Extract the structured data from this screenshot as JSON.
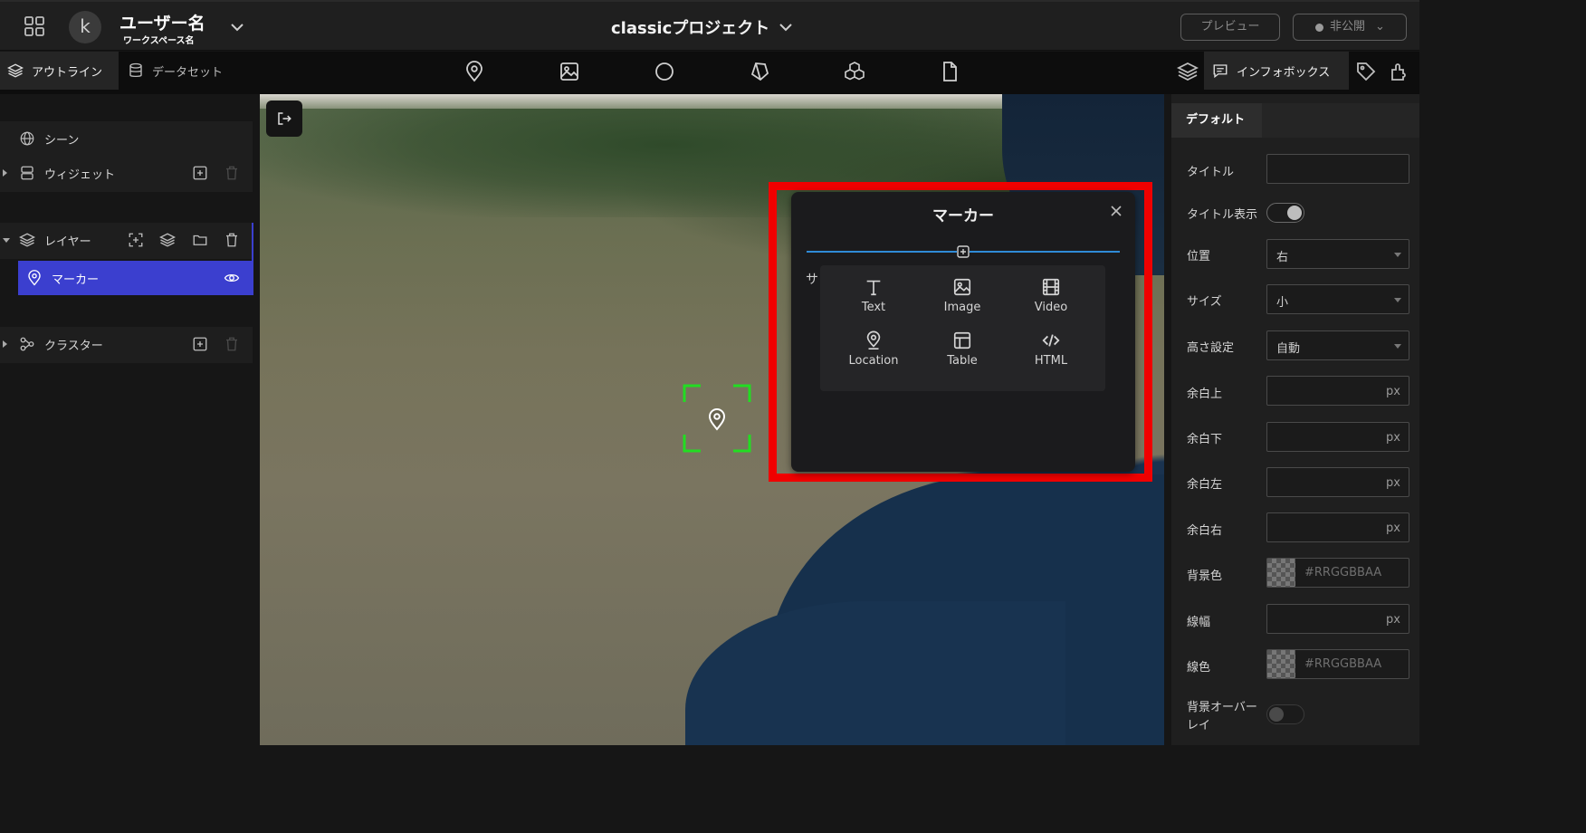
{
  "header": {
    "user_avatar_initial": "k",
    "user_name": "ユーザー名",
    "workspace_name": "ワークスペース名",
    "project_title": "classicプロジェクト",
    "preview_label": "プレビュー",
    "publish_status_label": "非公開"
  },
  "toolbar": {
    "left_tabs": [
      {
        "label": "アウトライン",
        "icon": "layers-icon",
        "active": true
      },
      {
        "label": "データセット",
        "icon": "database-icon",
        "active": false
      }
    ],
    "center_tools": [
      "marker-icon",
      "image-icon",
      "circle-icon",
      "polygon-icon",
      "model-icon",
      "file-icon"
    ],
    "right_tabs": [
      {
        "icon": "layers-icon"
      },
      {
        "label": "インフォボックス",
        "icon": "infobox-icon",
        "active": true
      },
      {
        "icon": "tag-icon"
      },
      {
        "icon": "plugin-icon"
      }
    ]
  },
  "outline": {
    "scene_label": "シーン",
    "widget_label": "ウィジェット",
    "layer_label": "レイヤー",
    "marker_label": "マーカー",
    "cluster_label": "クラスター"
  },
  "popup": {
    "title": "マーカー",
    "partial_text": "サ",
    "blocks": [
      {
        "label": "Text",
        "icon": "text-icon"
      },
      {
        "label": "Image",
        "icon": "image-icon"
      },
      {
        "label": "Video",
        "icon": "video-icon"
      },
      {
        "label": "Location",
        "icon": "location-icon"
      },
      {
        "label": "Table",
        "icon": "table-icon"
      },
      {
        "label": "HTML",
        "icon": "code-icon"
      }
    ]
  },
  "infobox": {
    "tab_default": "デフォルト",
    "fields": {
      "title_label": "タイトル",
      "title_value": "",
      "show_title_label": "タイトル表示",
      "show_title_on": true,
      "position_label": "位置",
      "position_value": "右",
      "size_label": "サイズ",
      "size_value": "小",
      "height_label": "高さ設定",
      "height_value": "自動",
      "margin_top_label": "余白上",
      "margin_bottom_label": "余白下",
      "margin_left_label": "余白左",
      "margin_right_label": "余白右",
      "unit": "px",
      "bg_color_label": "背景色",
      "color_placeholder": "#RRGGBBAA",
      "border_width_label": "線幅",
      "border_color_label": "線色",
      "bg_overlay_label_1": "背景オーバー",
      "bg_overlay_label_2": "レイ",
      "bg_overlay_on": false
    }
  },
  "colors": {
    "accent": "#3b3fcf",
    "highlight_frame": "#f00000",
    "focus_bracket": "#22dd22",
    "divider_line": "#2f8bd7"
  }
}
